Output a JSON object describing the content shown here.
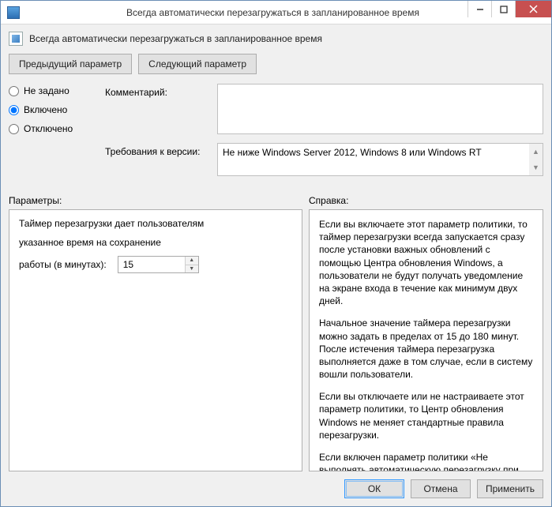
{
  "window": {
    "title": "Всегда автоматически перезагружаться в запланированное время"
  },
  "header": {
    "subtitle": "Всегда автоматически перезагружаться в запланированное время"
  },
  "nav": {
    "prev": "Предыдущий параметр",
    "next": "Следующий параметр"
  },
  "state": {
    "not_configured": "Не задано",
    "enabled": "Включено",
    "disabled": "Отключено",
    "selected": "enabled"
  },
  "fields": {
    "comment_label": "Комментарий:",
    "comment_value": "",
    "requirements_label": "Требования к версии:",
    "requirements_value": "Не ниже Windows Server 2012, Windows 8 или Windows RT"
  },
  "sections": {
    "options": "Параметры:",
    "help": "Справка:"
  },
  "options": {
    "line1": "Таймер перезагрузки дает пользователям",
    "line2": "указанное время на сохранение",
    "minutes_label": "работы (в минутах):",
    "minutes_value": "15"
  },
  "help": {
    "p1": "Если вы включаете этот параметр политики, то таймер перезагрузки всегда запускается сразу после установки важных обновлений с помощью Центра обновления Windows, а пользователи не будут получать уведомление на экране входа в течение как минимум двух дней.",
    "p2": "Начальное значение таймера перезагрузки можно задать в пределах от 15 до 180 минут. После истечения таймера перезагрузка выполняется даже в том случае, если в систему вошли пользователи.",
    "p3": "Если вы отключаете или не настраиваете этот параметр политики, то Центр обновления Windows не меняет стандартные правила перезагрузки.",
    "p4": "Если включен параметр политики «Не выполнять автоматическую перезагрузку при автоматической установке обновлений, если в системе работают"
  },
  "footer": {
    "ok": "ОК",
    "cancel": "Отмена",
    "apply": "Применить"
  }
}
